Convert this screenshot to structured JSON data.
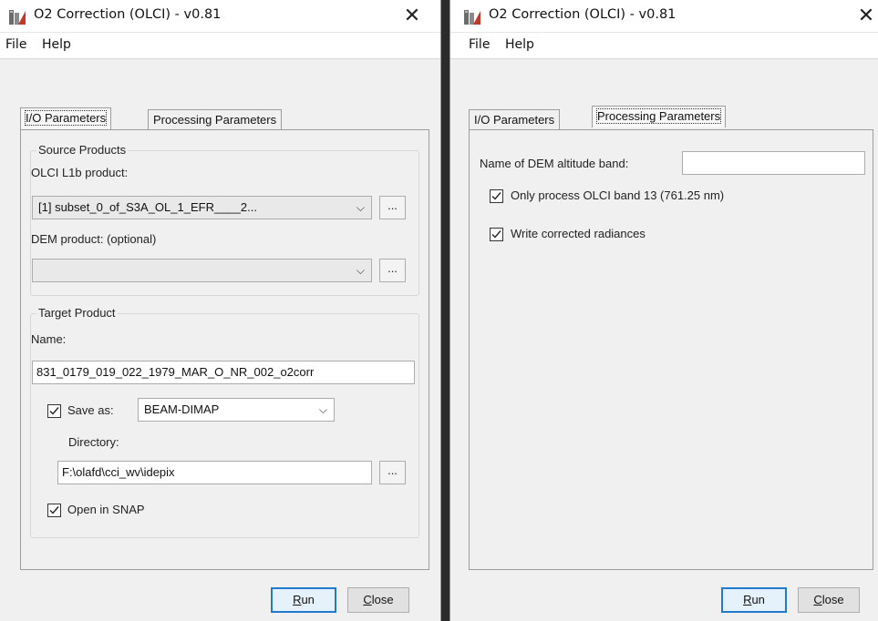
{
  "window_title": "O2 Correction (OLCI) - v0.81",
  "menu": {
    "file": "File",
    "help": "Help"
  },
  "tabs": {
    "io": "I/O Parameters",
    "processing": "Processing Parameters"
  },
  "io_params": {
    "source_products_title": "Source Products",
    "olci_label": "OLCI L1b product:",
    "olci_value": "[1] subset_0_of_S3A_OL_1_EFR____2...",
    "dem_label": "DEM product: (optional)",
    "dem_value": "",
    "target_product_title": "Target Product",
    "name_label": "Name:",
    "name_value": "831_0179_019_022_1979_MAR_O_NR_002_o2corr",
    "save_as_label": "Save as:",
    "save_as_checked": true,
    "format_value": "BEAM-DIMAP",
    "directory_label": "Directory:",
    "directory_value": "F:\\olafd\\cci_wv\\idepix",
    "open_in_snap_label": "Open in SNAP",
    "open_in_snap_checked": true
  },
  "processing_params": {
    "dem_band_label": "Name of DEM altitude band:",
    "dem_band_value": "",
    "only_band13_label": "Only process OLCI band 13 (761.25 nm)",
    "only_band13_checked": true,
    "write_corrected_label": "Write corrected radiances",
    "write_corrected_checked": true
  },
  "buttons": {
    "run_mnemonic": "R",
    "run_rest": "un",
    "close_mnemonic": "C",
    "close_rest": "lose",
    "browse": "..."
  },
  "icons": {
    "app": "snap-app-icon",
    "close": "close-icon",
    "dropdown": "chevron-down-icon",
    "check": "checkmark-icon"
  },
  "colors": {
    "default_button_border": "#1f7ad0",
    "window_border": "#7a96b8"
  }
}
